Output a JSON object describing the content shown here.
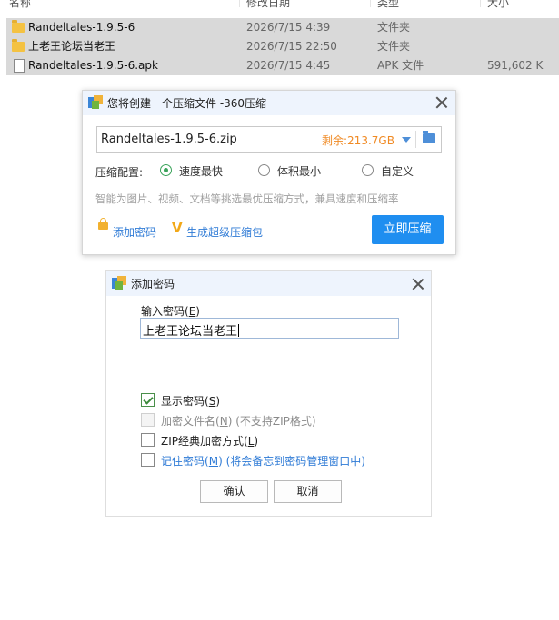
{
  "explorer": {
    "headers": {
      "name": "名称",
      "date": "修改日期",
      "type": "类型",
      "size": "大小"
    },
    "rows": [
      {
        "name": "Randeltales-1.9.5-6",
        "date": "2026/7/15 4:39",
        "type": "文件夹",
        "size": "",
        "icon": "folder-icon",
        "selected": true
      },
      {
        "name": "上老王论坛当老王",
        "date": "2026/7/15 22:50",
        "type": "文件夹",
        "size": "",
        "icon": "folder-icon",
        "selected": true
      },
      {
        "name": "Randeltales-1.9.5-6.apk",
        "date": "2026/7/15 4:45",
        "type": "APK 文件",
        "size": "591,602 K",
        "icon": "file-icon",
        "selected": true
      }
    ]
  },
  "compress_dialog": {
    "title": "您将创建一个压缩文件 -360压缩",
    "filename": "Randeltales-1.9.5-6.zip",
    "free_space": "剩余:213.7GB",
    "config_label": "压缩配置:",
    "options": [
      "速度最快",
      "体积最小",
      "自定义"
    ],
    "selected_option": "速度最快",
    "hint": "智能为图片、视频、文档等挑选最优压缩方式，兼具速度和压缩率",
    "add_password_link": "添加密码",
    "super_package_link": "生成超级压缩包",
    "compress_button": "立即压缩"
  },
  "password_dialog": {
    "title": "添加密码",
    "input_label": "输入密码",
    "input_key": "E",
    "password_value": "上老王论坛当老王",
    "show_password": {
      "label": "显示密码",
      "key": "S",
      "checked": true
    },
    "encrypt_names": {
      "label": "加密文件名",
      "key": "N",
      "note": "(不支持ZIP格式)",
      "checked": false,
      "disabled": true
    },
    "zip_classic": {
      "label": "ZIP经典加密方式",
      "key": "L",
      "checked": false
    },
    "remember": {
      "label": "记住密码",
      "key": "M",
      "note": "(将会备忘到密码管理窗口中)",
      "checked": false
    },
    "ok_button": "确认",
    "cancel_button": "取消"
  },
  "colors": {
    "accent_blue": "#1f8ef0",
    "link_blue": "#2f7bd6",
    "free_space_orange": "#f08a24",
    "check_green": "#3aa35a",
    "selection_gray": "#d9d9d9"
  }
}
